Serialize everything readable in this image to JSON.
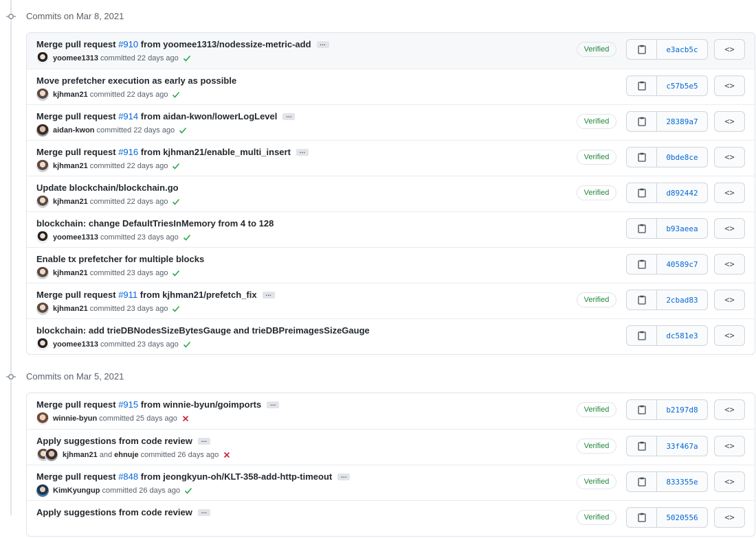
{
  "colors": {
    "link": "#0366d6",
    "verified": "#22863a",
    "success": "#28a745",
    "failure": "#cb2431",
    "border": "#e1e4e8"
  },
  "groups": [
    {
      "title": "Commits on Mar 8, 2021",
      "commits": [
        {
          "prefix": "Merge pull request ",
          "pr": "#910",
          "suffix": " from yoomee1313/nodessize-metric-add",
          "has_ellipsis": true,
          "authors": [
            "yoomee1313"
          ],
          "time": "22 days ago",
          "status": "success",
          "verified": "Verified",
          "sha": "e3acb5c"
        },
        {
          "prefix": "Move prefetcher execution as early as possible",
          "pr": "",
          "suffix": "",
          "has_ellipsis": false,
          "authors": [
            "kjhman21"
          ],
          "time": "22 days ago",
          "status": "success",
          "verified": "",
          "sha": "c57b5e5"
        },
        {
          "prefix": "Merge pull request ",
          "pr": "#914",
          "suffix": " from aidan-kwon/lowerLogLevel",
          "has_ellipsis": true,
          "authors": [
            "aidan-kwon"
          ],
          "time": "22 days ago",
          "status": "success",
          "verified": "Verified",
          "sha": "28389a7"
        },
        {
          "prefix": "Merge pull request ",
          "pr": "#916",
          "suffix": " from kjhman21/enable_multi_insert",
          "has_ellipsis": true,
          "authors": [
            "kjhman21"
          ],
          "time": "22 days ago",
          "status": "success",
          "verified": "Verified",
          "sha": "0bde8ce"
        },
        {
          "prefix": "Update blockchain/blockchain.go",
          "pr": "",
          "suffix": "",
          "has_ellipsis": false,
          "authors": [
            "kjhman21"
          ],
          "time": "22 days ago",
          "status": "success",
          "verified": "Verified",
          "sha": "d892442"
        },
        {
          "prefix": "blockchain: change DefaultTriesInMemory from 4 to 128",
          "pr": "",
          "suffix": "",
          "has_ellipsis": false,
          "authors": [
            "yoomee1313"
          ],
          "time": "23 days ago",
          "status": "success",
          "verified": "",
          "sha": "b93aeea"
        },
        {
          "prefix": "Enable tx prefetcher for multiple blocks",
          "pr": "",
          "suffix": "",
          "has_ellipsis": false,
          "authors": [
            "kjhman21"
          ],
          "time": "23 days ago",
          "status": "success",
          "verified": "",
          "sha": "40589c7"
        },
        {
          "prefix": "Merge pull request ",
          "pr": "#911",
          "suffix": " from kjhman21/prefetch_fix",
          "has_ellipsis": true,
          "authors": [
            "kjhman21"
          ],
          "time": "23 days ago",
          "status": "success",
          "verified": "Verified",
          "sha": "2cbad83"
        },
        {
          "prefix": "blockchain: add trieDBNodesSizeBytesGauge and trieDBPreimagesSizeGauge",
          "pr": "",
          "suffix": "",
          "has_ellipsis": false,
          "authors": [
            "yoomee1313"
          ],
          "time": "23 days ago",
          "status": "success",
          "verified": "",
          "sha": "dc581e3"
        }
      ]
    },
    {
      "title": "Commits on Mar 5, 2021",
      "commits": [
        {
          "prefix": "Merge pull request ",
          "pr": "#915",
          "suffix": " from winnie-byun/goimports",
          "has_ellipsis": true,
          "authors": [
            "winnie-byun"
          ],
          "time": "25 days ago",
          "status": "failure",
          "verified": "Verified",
          "sha": "b2197d8"
        },
        {
          "prefix": "Apply suggestions from code review",
          "pr": "",
          "suffix": "",
          "has_ellipsis": true,
          "authors": [
            "kjhman21",
            "ehnuje"
          ],
          "time": "26 days ago",
          "status": "failure",
          "verified": "Verified",
          "sha": "33f467a"
        },
        {
          "prefix": "Merge pull request ",
          "pr": "#848",
          "suffix": " from jeongkyun-oh/KLT-358-add-http-timeout",
          "has_ellipsis": true,
          "authors": [
            "KimKyungup"
          ],
          "time": "26 days ago",
          "status": "success",
          "verified": "Verified",
          "sha": "833355e"
        },
        {
          "prefix": "Apply suggestions from code review",
          "pr": "",
          "suffix": "",
          "has_ellipsis": true,
          "authors": [],
          "time": "",
          "status": "",
          "verified": "Verified",
          "sha": "5020556"
        }
      ]
    }
  ],
  "labels": {
    "committed": "committed",
    "and": "and",
    "ellipsis": "…",
    "browse": "<>"
  },
  "icons": {
    "commit_dot": "git-commit-icon",
    "copy": "clipboard-icon",
    "success": "check-icon",
    "failure": "x-icon"
  }
}
